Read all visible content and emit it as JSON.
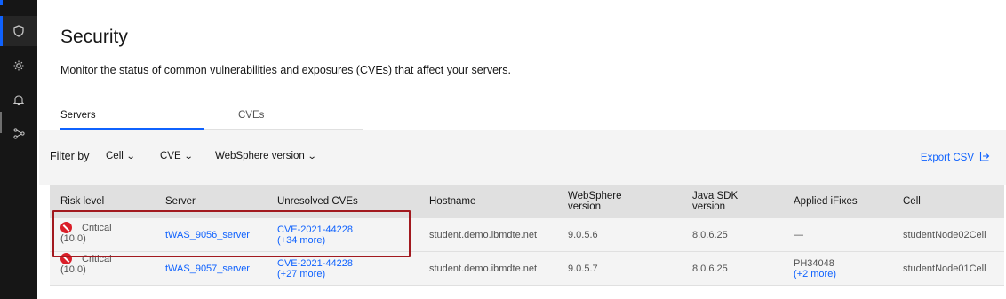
{
  "header": {
    "title": "Security",
    "description": "Monitor the status of common vulnerabilities and exposures (CVEs) that affect your servers."
  },
  "tabs": [
    {
      "label": "Servers",
      "selected": true
    },
    {
      "label": "CVEs",
      "selected": false
    }
  ],
  "filters": {
    "label": "Filter by",
    "dropdowns": [
      "Cell",
      "CVE",
      "WebSphere version"
    ],
    "export_label": "Export CSV"
  },
  "table": {
    "columns": [
      "Risk level",
      "Server",
      "Unresolved CVEs",
      "Hostname",
      "WebSphere version",
      "Java SDK version",
      "Applied iFixes",
      "Cell"
    ],
    "rows": [
      {
        "risk": "Critical",
        "score": "(10.0)",
        "server": "tWAS_9056_server",
        "cve": "CVE-2021-44228",
        "cve_more": "(+34 more)",
        "hostname": "student.demo.ibmdte.net",
        "websphere": "9.0.5.6",
        "java": "8.0.6.25",
        "ifix": "—",
        "ifix_more": "",
        "cell": "studentNode02Cell"
      },
      {
        "risk": "Critical",
        "score": "(10.0)",
        "server": "tWAS_9057_server",
        "cve": "CVE-2021-44228",
        "cve_more": "(+27 more)",
        "hostname": "student.demo.ibmdte.net",
        "websphere": "9.0.5.7",
        "java": "8.0.6.25",
        "ifix": "PH34048",
        "ifix_more": "(+2 more)",
        "cell": "studentNode01Cell"
      }
    ]
  },
  "icons": {
    "rail": [
      "security-shield-icon",
      "settings-gear-icon",
      "notification-bell-icon",
      "topology-icon"
    ],
    "filter_chevron": "chevron-down-icon",
    "export": "export-icon",
    "risk": "critical-risk-icon"
  },
  "colors": {
    "accent": "#0f62fe",
    "critical": "#da1e28",
    "highlight_border": "#a2191f",
    "rail_bg": "#161616"
  }
}
